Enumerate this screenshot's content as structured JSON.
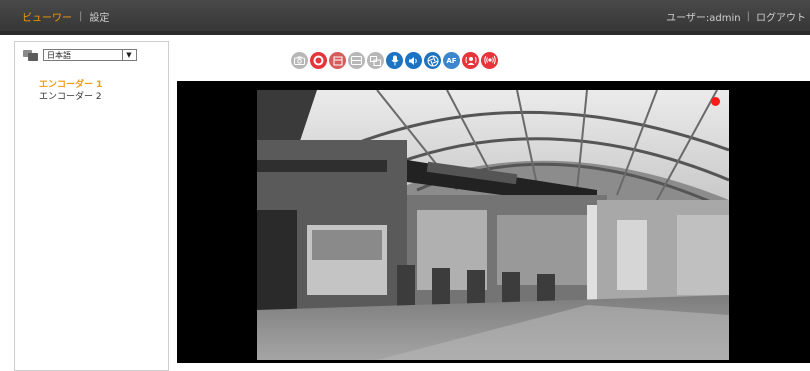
{
  "header": {
    "nav": [
      {
        "label": "ビューワー",
        "active": true
      },
      {
        "label": "設定",
        "active": false
      }
    ],
    "user_label": "ユーザー:admin",
    "logout_label": "ログアウト",
    "separator": "|"
  },
  "sidebar": {
    "language": {
      "selected": "日本語"
    },
    "encoders": [
      {
        "label": "エンコーダー 1",
        "active": true
      },
      {
        "label": "エンコーダー 2",
        "active": false
      }
    ]
  },
  "toolbar": {
    "buttons": [
      {
        "icon": "camera-icon",
        "color": "#b7b7b7"
      },
      {
        "icon": "record-icon",
        "color": "#e5343a"
      },
      {
        "icon": "film-icon",
        "color": "#d75b5b"
      },
      {
        "icon": "monitor-icon",
        "color": "#b7b7b7"
      },
      {
        "icon": "multiscreen-icon",
        "color": "#b7b7b7"
      },
      {
        "icon": "microphone-icon",
        "color": "#1c73c2"
      },
      {
        "icon": "speaker-icon",
        "color": "#1c73c2"
      },
      {
        "icon": "aperture-icon",
        "color": "#1c73c2"
      },
      {
        "icon": "autofocus-icon",
        "label": "AF",
        "color": "#3b86cc"
      },
      {
        "icon": "alarm-person-icon",
        "color": "#e5343a"
      },
      {
        "icon": "alarm-signal-icon",
        "color": "#e5343a"
      }
    ]
  },
  "viewer": {
    "recording_indicator_color": "#ff1a1a"
  },
  "colors": {
    "accent": "#f39b0f",
    "header_bg": "#3f3f3f"
  }
}
